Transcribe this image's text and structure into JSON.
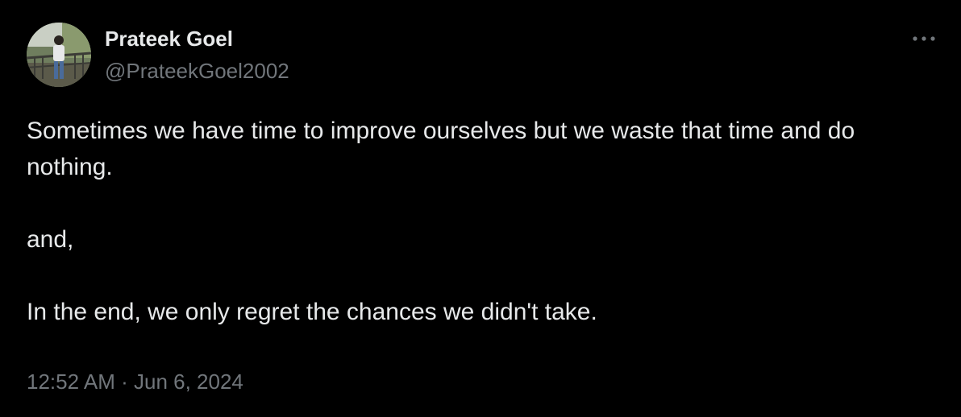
{
  "tweet": {
    "author": {
      "display_name": "Prateek Goel",
      "handle": "@PrateekGoel2002"
    },
    "paragraphs": [
      "Sometimes we have time to improve ourselves but we waste that time and do nothing.",
      "and,",
      "In the end, we only regret the chances we didn't take."
    ],
    "time": "12:52 AM",
    "separator": "·",
    "date": "Jun 6, 2024"
  },
  "icons": {
    "more": "more-horizontal-icon",
    "avatar": "profile-photo"
  },
  "colors": {
    "background": "#000000",
    "primary_text": "#e7e9ea",
    "secondary_text": "#71767b"
  }
}
